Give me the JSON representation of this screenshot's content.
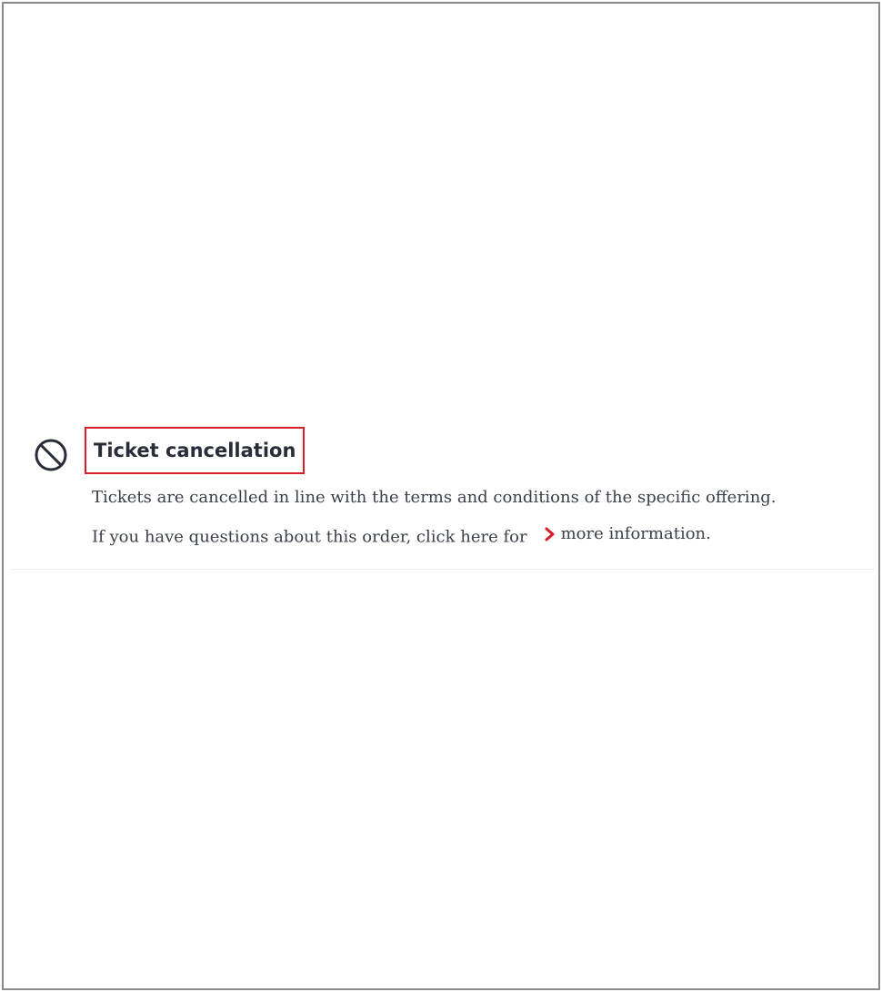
{
  "cancellation": {
    "icon": "block-icon",
    "title": "Ticket cancellation",
    "description": "Tickets are cancelled in line with the terms and conditions of the specific offering.",
    "questions_text": "If you have questions about this order, click here for",
    "link_icon": "chevron-right-icon",
    "link_text": "more information.",
    "accent_color": "#d81e27"
  }
}
